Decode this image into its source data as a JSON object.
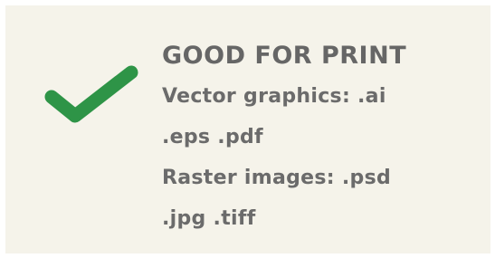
{
  "icon": {
    "name": "checkmark-icon",
    "color": "#2e9447"
  },
  "content": {
    "title": "GOOD FOR PRINT",
    "lines": [
      "Vector graphics: .ai",
      ".eps .pdf",
      "Raster images: .psd",
      ".jpg .tiff"
    ]
  }
}
